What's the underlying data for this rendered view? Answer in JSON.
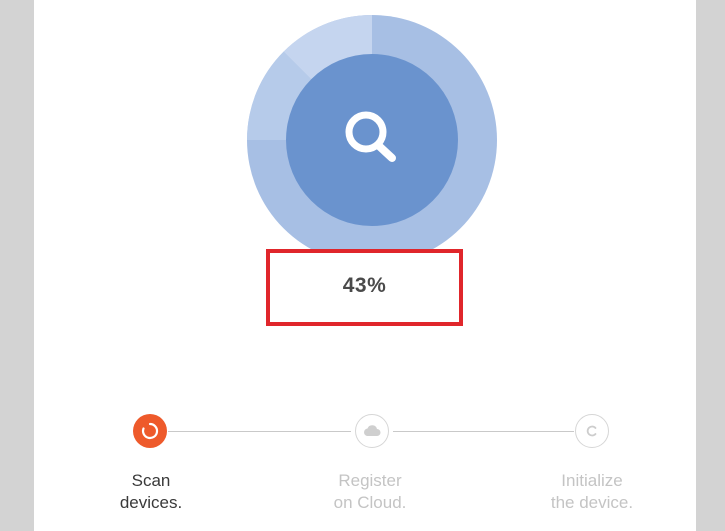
{
  "progress": {
    "percent_text": "43%",
    "value": 0.43
  },
  "icons": {
    "center": "search-icon",
    "step1": "spinner-icon",
    "step2": "cloud-icon",
    "step3": "copyright-c-icon"
  },
  "steps": [
    {
      "line1": "Scan",
      "line2": "devices.",
      "state": "active"
    },
    {
      "line1": "Register",
      "line2": "on Cloud.",
      "state": "inactive"
    },
    {
      "line1": "Initialize",
      "line2": "the device.",
      "state": "inactive"
    }
  ],
  "colors": {
    "radar_outer": "#a7bfe4",
    "radar_sweep": "#c9d7ef",
    "radar_inner": "#6a93ce",
    "active_step": "#ee5a2b",
    "highlight_box": "#e0262b"
  }
}
